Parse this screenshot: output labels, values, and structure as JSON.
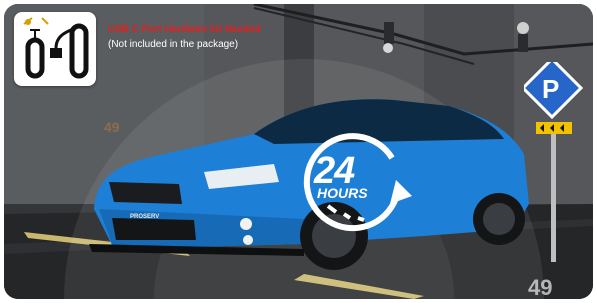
{
  "kit": {
    "title": "USB C Port Hardwire kit Needed",
    "note": "(Not included in the package)",
    "icon": "hardwire-cable-icon"
  },
  "badge": {
    "number": "24",
    "unit": "HOURS",
    "icon": "clock-arrow-icon"
  },
  "sign": {
    "letter": "P",
    "icon": "parking-sign-icon"
  },
  "car": {
    "plate": "PROSERV",
    "color": "#1d7fd6"
  },
  "ground_marks": {
    "left": "49",
    "right": "49"
  },
  "colors": {
    "accent_red": "#e02020",
    "sign_blue": "#2566c8",
    "sign_yellow": "#f2c200"
  }
}
